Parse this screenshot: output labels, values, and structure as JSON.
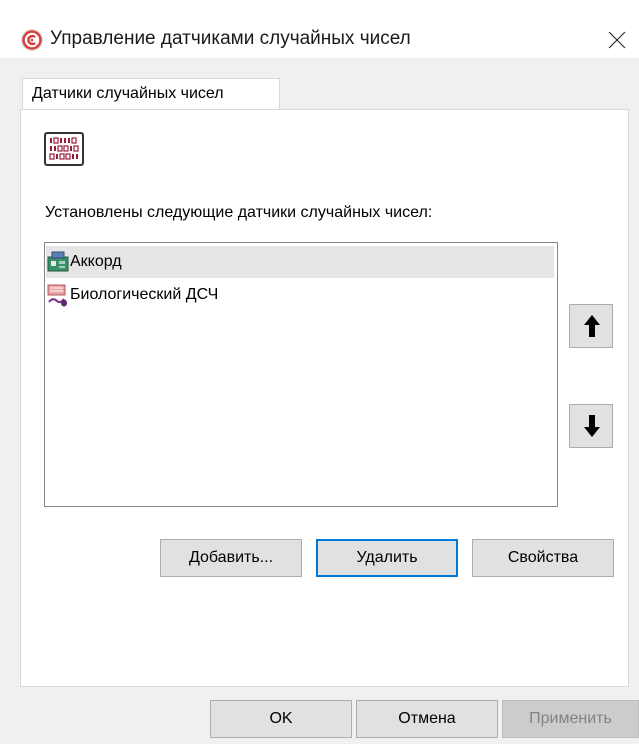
{
  "window": {
    "title": "Управление датчиками случайных чисел",
    "app_icon": "circle-logo-icon",
    "close_icon": "close-icon"
  },
  "tabs": [
    {
      "label": "Датчики случайных чисел",
      "selected": true
    }
  ],
  "panel": {
    "header_icon": "random-number-generator-icon",
    "installed_label": "Установлены следующие датчики случайных чисел:",
    "list_items": [
      {
        "label": "Аккорд",
        "icon": "hardware-board-icon",
        "selected": true
      },
      {
        "label": "Биологический ДСЧ",
        "icon": "keyboard-mouse-icon",
        "selected": false
      }
    ],
    "move_up_icon": "move-up-arrow-icon",
    "move_down_icon": "move-down-arrow-icon",
    "buttons": {
      "add": "Добавить...",
      "remove": "Удалить",
      "properties": "Свойства"
    }
  },
  "footer": {
    "ok": "OK",
    "cancel": "Отмена",
    "apply": "Применить"
  },
  "colors": {
    "accent": "#0078d7",
    "selection": "#e5e5e5",
    "button_face": "#e1e1e1",
    "disabled_text": "#838383"
  }
}
